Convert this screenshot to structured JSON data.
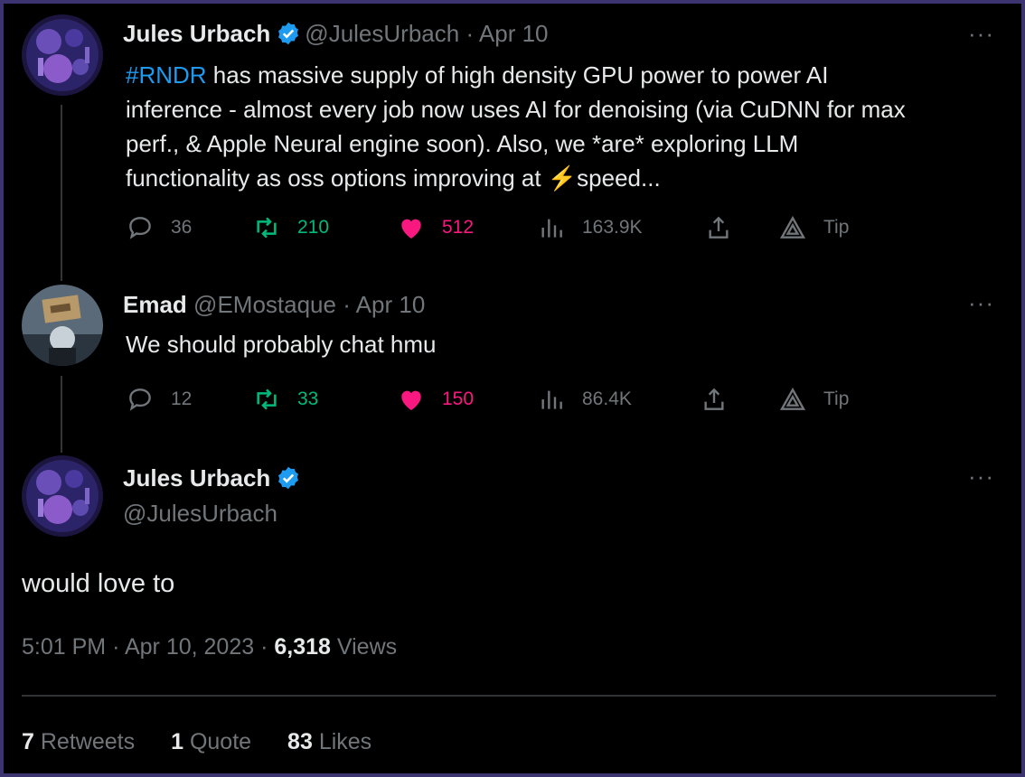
{
  "tweets": [
    {
      "name": "Jules Urbach",
      "handle": "@JulesUrbach",
      "date_sep": "·",
      "date": "Apr 10",
      "text_hashtag": "#RNDR",
      "text_line1": " has massive supply of high density GPU power to power AI",
      "text_line2": "inference - almost every job now uses AI for denoising (via CuDNN for max",
      "text_line3": "perf., & Apple Neural engine soon).  Also, we *are* exploring LLM",
      "text_line4_a": "functionality as oss options improving at ",
      "text_line4_emoji": "⚡",
      "text_line4_b": "speed...",
      "replies": "36",
      "retweets": "210",
      "likes": "512",
      "views": "163.9K",
      "tip": "Tip",
      "more": "···"
    },
    {
      "name": "Emad",
      "handle": "@EMostaque",
      "date_sep": "·",
      "date": "Apr 10",
      "text": "We should probably chat hmu",
      "replies": "12",
      "retweets": "33",
      "likes": "150",
      "views": "86.4K",
      "tip": "Tip",
      "more": "···"
    }
  ],
  "main": {
    "name": "Jules Urbach",
    "handle": "@JulesUrbach",
    "more": "···",
    "text": "would love to",
    "time": "5:01 PM",
    "sep": "·",
    "date": "Apr 10, 2023",
    "sep2": "·",
    "views_count": "6,318",
    "views_label": "Views",
    "stats": {
      "retweets_count": "7",
      "retweets_label": "Retweets",
      "quotes_count": "1",
      "quotes_label": "Quote",
      "likes_count": "83",
      "likes_label": "Likes"
    }
  },
  "colors": {
    "accent": "#1d9bf0",
    "retweet": "#00ba7c",
    "like": "#f91880",
    "muted": "#71767b"
  },
  "icons": [
    "reply-icon",
    "retweet-icon",
    "like-icon",
    "views-icon",
    "share-icon",
    "tip-icon",
    "verified-icon",
    "more-icon"
  ]
}
